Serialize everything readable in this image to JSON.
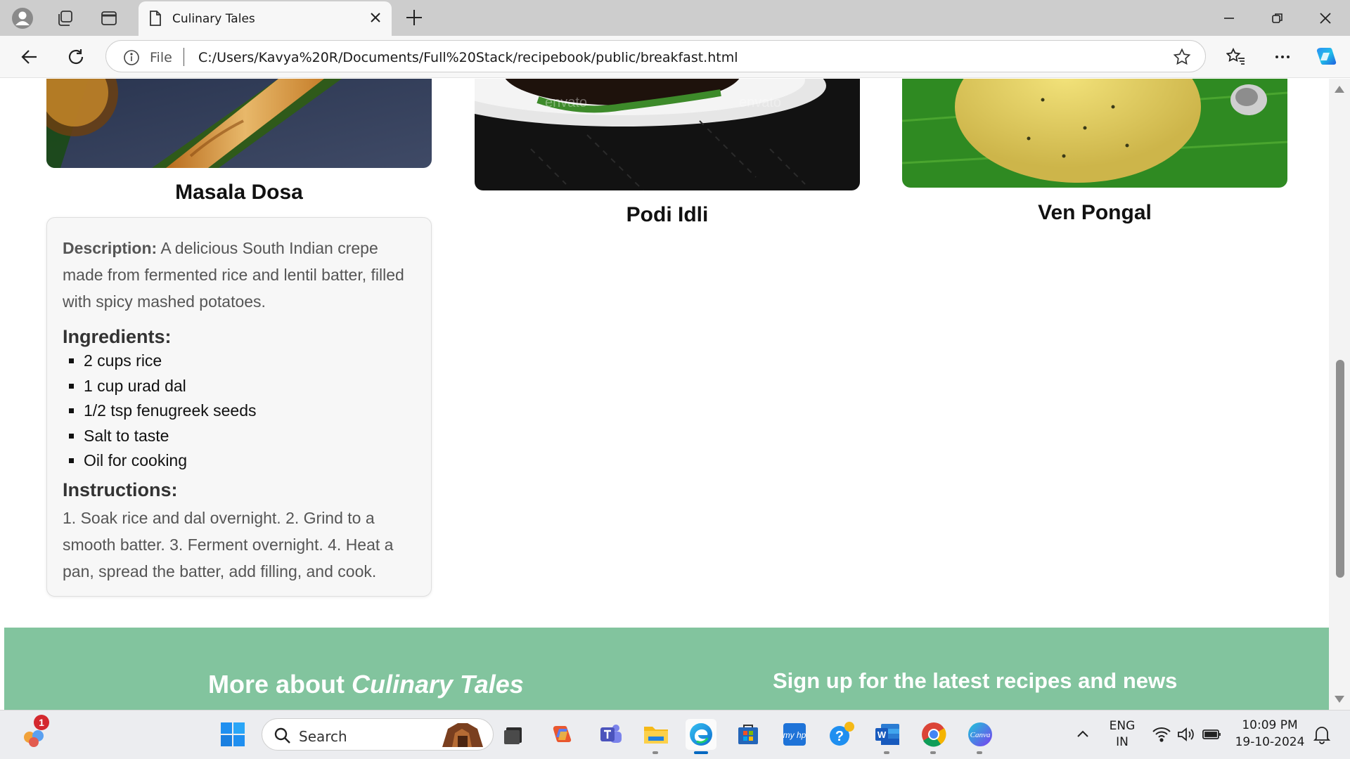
{
  "browser": {
    "tab_title": "Culinary Tales",
    "address_scheme_label": "File",
    "url": "C:/Users/Kavya%20R/Documents/Full%20Stack/recipebook/public/breakfast.html"
  },
  "recipes": [
    {
      "name": "Masala Dosa"
    },
    {
      "name": "Podi Idli"
    },
    {
      "name": "Ven Pongal"
    }
  ],
  "details": {
    "description_label": "Description:",
    "description_text": "A delicious South Indian crepe made from fermented rice and lentil batter, filled with spicy mashed potatoes.",
    "ingredients_heading": "Ingredients:",
    "ingredients": [
      "2 cups rice",
      "1 cup urad dal",
      "1/2 tsp fenugreek seeds",
      "Salt to taste",
      "Oil for cooking"
    ],
    "instructions_heading": "Instructions:",
    "instructions_text": "1. Soak rice and dal overnight. 2. Grind to a smooth batter. 3. Ferment overnight. 4. Heat a pan, spread the batter, add filling, and cook."
  },
  "footer": {
    "about_prefix": "More about ",
    "about_brand": "Culinary Tales",
    "signup": "Sign up for the latest recipes and news"
  },
  "image_watermark": "envato",
  "taskbar": {
    "search_label": "Search",
    "notification_count": "1",
    "language": "ENG",
    "region": "IN",
    "time": "10:09 PM",
    "date": "19-10-2024"
  },
  "colors": {
    "footer_bg": "#82c49e",
    "accent": "#0067c0"
  }
}
